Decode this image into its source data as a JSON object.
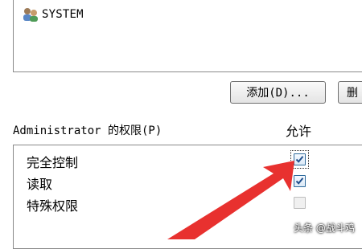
{
  "users": {
    "items": [
      {
        "label": "SYSTEM",
        "icon": "user-group-icon"
      }
    ]
  },
  "buttons": {
    "add_label": "添加(D)...",
    "next_label": "删"
  },
  "permissions": {
    "header": "Administrator 的权限(P)",
    "allow_header": "允许",
    "rows": [
      {
        "label": "完全控制",
        "allow": true,
        "enabled": true
      },
      {
        "label": "读取",
        "allow": true,
        "enabled": true
      },
      {
        "label": "特殊权限",
        "allow": false,
        "enabled": false
      }
    ]
  },
  "annotation": {
    "arrow_color": "#e8312f",
    "points_to": "full-control-checkbox"
  },
  "watermark": {
    "text": "头条 @战斗鸡"
  }
}
